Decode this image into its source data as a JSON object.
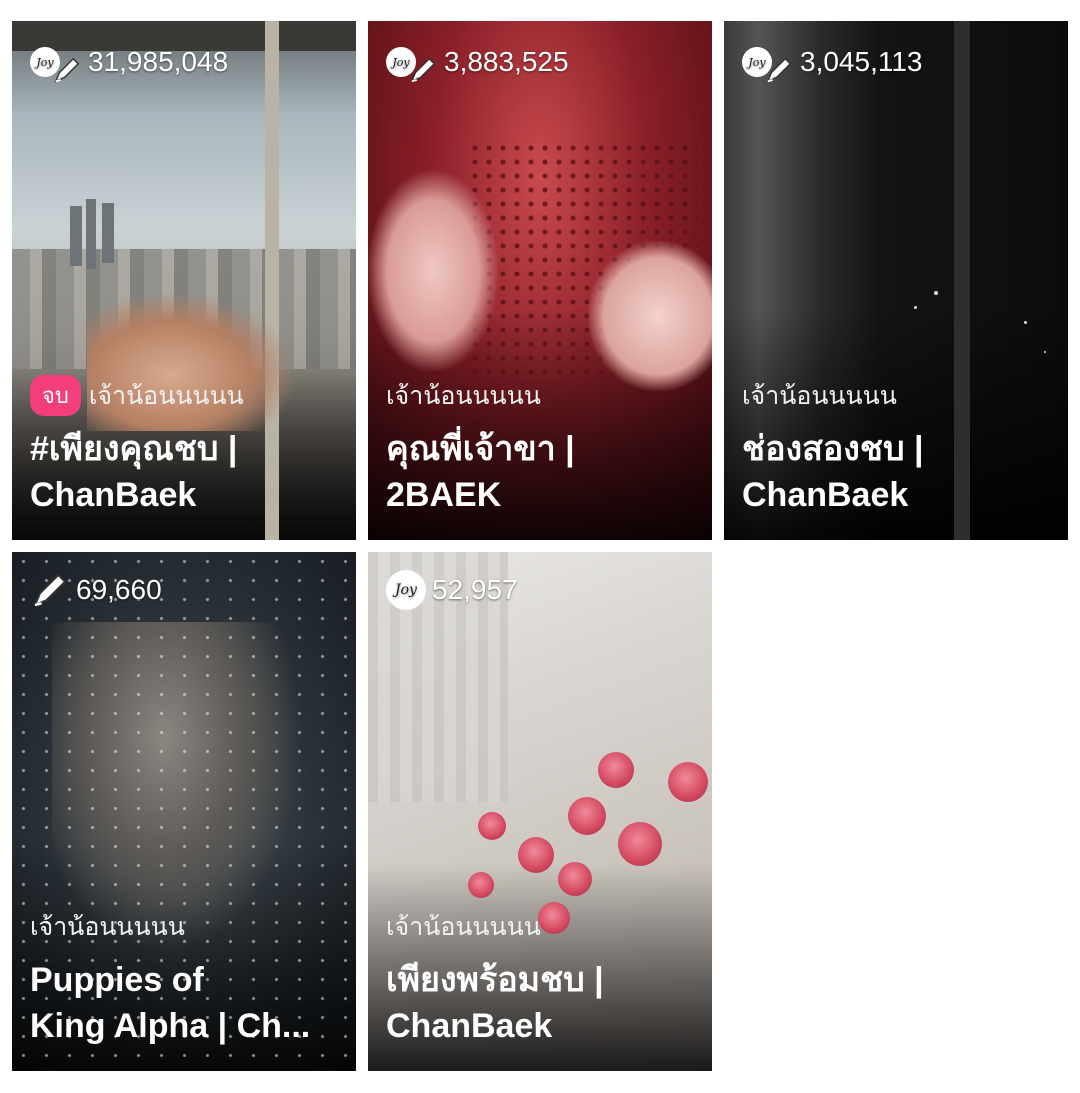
{
  "cards": [
    {
      "stat": "31,985,048",
      "badge": "จบ",
      "author": "เจ้าน้อนนนนน",
      "title_line1": "#เพียงคุณชบ |",
      "title_line2": "ChanBaek",
      "icons": [
        "joy-icon",
        "pen-icon"
      ]
    },
    {
      "stat": "3,883,525",
      "author": "เจ้าน้อนนนนน",
      "title_line1": "คุณพี่เจ้าขา |",
      "title_line2": "2BAEK",
      "icons": [
        "joy-icon",
        "pen-icon"
      ]
    },
    {
      "stat": "3,045,113",
      "author": "เจ้าน้อนนนนน",
      "title_line1": "ช่องสองชบ |",
      "title_line2": "ChanBaek",
      "icons": [
        "joy-icon",
        "pen-icon"
      ]
    },
    {
      "stat": "69,660",
      "author": "เจ้าน้อนนนนน",
      "title_line1": "Puppies of",
      "title_line2": "King Alpha | Ch...",
      "icons": [
        "pen-icon"
      ]
    },
    {
      "stat": "52,957",
      "author": "เจ้าน้อนนนนน",
      "title_line1": "เพียงพร้อมชบ |",
      "title_line2": "ChanBaek",
      "icons": [
        "joy-icon"
      ]
    }
  ],
  "icon_labels": {
    "joy": "Joy"
  },
  "colors": {
    "badge": "#f23e7b",
    "text": "#ffffff",
    "background": "#ffffff"
  }
}
